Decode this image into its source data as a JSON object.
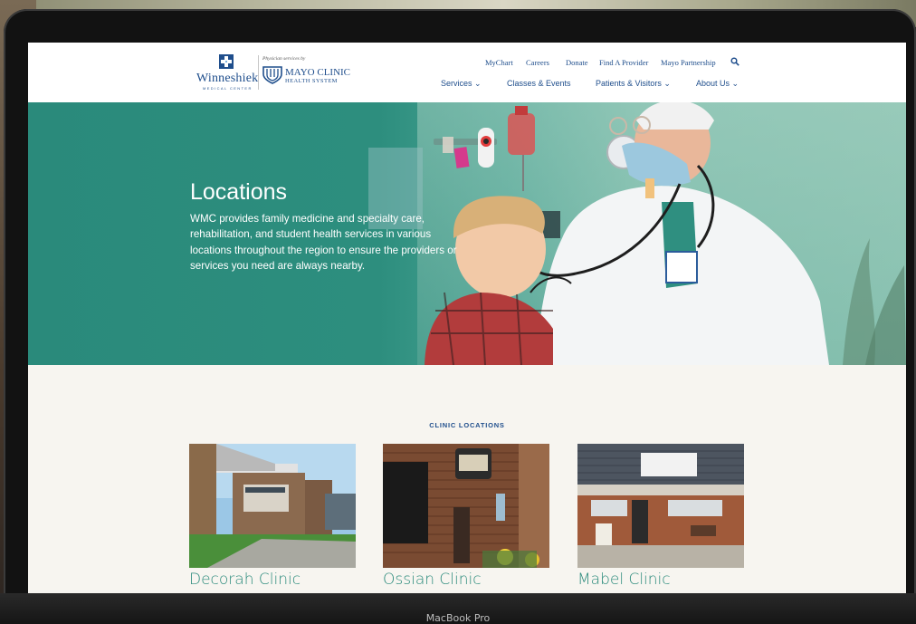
{
  "device": {
    "label": "MacBook Pro"
  },
  "header": {
    "logo": {
      "name": "Winneshiek",
      "sub": "MEDICAL CENTER",
      "physician": "Physician services by",
      "partner_name": "MAYO CLINIC",
      "partner_sub": "HEALTH SYSTEM"
    },
    "utility_nav": [
      "MyChart",
      "Careers",
      "Donate",
      "Find A Provider",
      "Mayo Partnership"
    ],
    "main_nav": [
      "Services ⌄",
      "Classes & Events",
      "Patients & Visitors ⌄",
      "About Us ⌄"
    ]
  },
  "hero": {
    "title": "Locations",
    "text": "WMC provides family medicine and specialty care, rehabilitation, and student health services in various locations throughout the region to ensure the providers or services you need are always nearby."
  },
  "section": {
    "heading": "CLINIC LOCATIONS",
    "clinics": [
      {
        "name": "Decorah Clinic"
      },
      {
        "name": "Ossian Clinic"
      },
      {
        "name": "Mabel Clinic"
      }
    ]
  },
  "colors": {
    "brand_blue": "#1f4e8c",
    "brand_teal": "#2a8a7b",
    "page_bg": "#f7f5f0"
  }
}
